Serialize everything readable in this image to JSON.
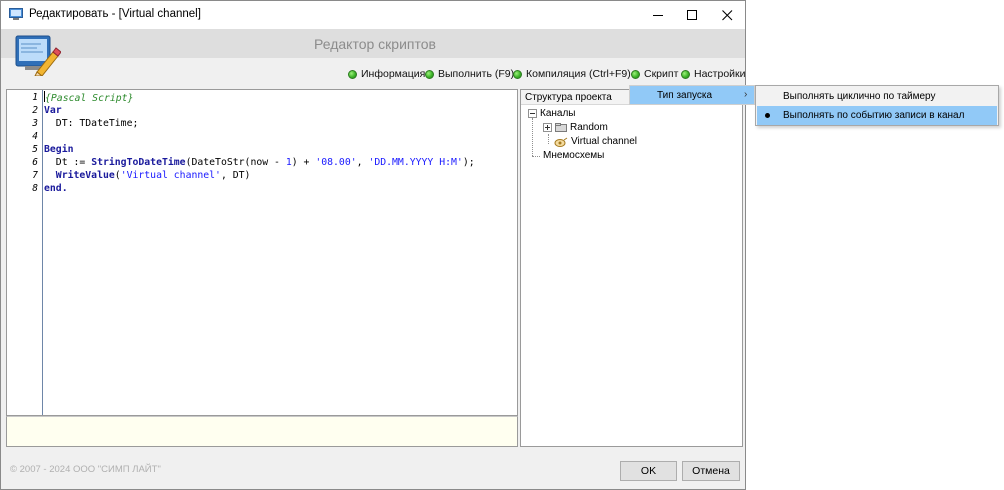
{
  "window": {
    "title": "Редактировать - [Virtual channel]",
    "header_title": "Редактор скриптов"
  },
  "toolbar": [
    {
      "label": "Информация",
      "icon": "green-dot-icon"
    },
    {
      "label": "Выполнить (F9)",
      "icon": "green-dot-icon"
    },
    {
      "label": "Компиляция (Ctrl+F9)",
      "icon": "green-dot-icon"
    },
    {
      "label": "Скрипт",
      "icon": "green-dot-icon"
    },
    {
      "label": "Настройки",
      "icon": "green-dot-icon"
    }
  ],
  "editor": {
    "line_numbers": [
      "1",
      "2",
      "3",
      "4",
      "5",
      "6",
      "7",
      "8"
    ],
    "code": {
      "l1": "{Pascal Script}",
      "l2": "Var",
      "l3": "  DT: TDateTime;",
      "l5": "Begin",
      "l6_a": "  Dt := ",
      "l6_fn": "StringToDateTime",
      "l6_b": "(DateToStr(now - ",
      "l6_num": "1",
      "l6_c": ") + ",
      "l6_str1": "'08.00'",
      "l6_d": ", ",
      "l6_str2": "'DD.MM.YYYY H:M'",
      "l6_e": ");",
      "l7_indent": "  ",
      "l7_fn": "WriteValue",
      "l7_a": "(",
      "l7_str": "'Virtual channel'",
      "l7_b": ", DT)",
      "l8": "end."
    }
  },
  "project_tree": {
    "header": "Структура проекта",
    "channels": "Каналы",
    "random": "Random",
    "virtual_channel": "Virtual channel",
    "mnemoschemes": "Мнемосхемы"
  },
  "context_menu": {
    "submenu_label": "Тип запуска",
    "items": [
      {
        "label": "Выполнять циклично по таймеру",
        "selected": false
      },
      {
        "label": "Выполнять по событию записи в канал",
        "selected": true
      }
    ]
  },
  "footer": {
    "copyright": "© 2007 - 2024 ООО \"СИМП ЛАЙТ\"",
    "ok_label": "OK",
    "cancel_label": "Отмена"
  },
  "colors": {
    "highlight": "#91c9f7",
    "keyword": "#1a1a9c",
    "comment": "#2e8b2e",
    "string": "#1a1aff",
    "status_green": "#3fb52a"
  }
}
